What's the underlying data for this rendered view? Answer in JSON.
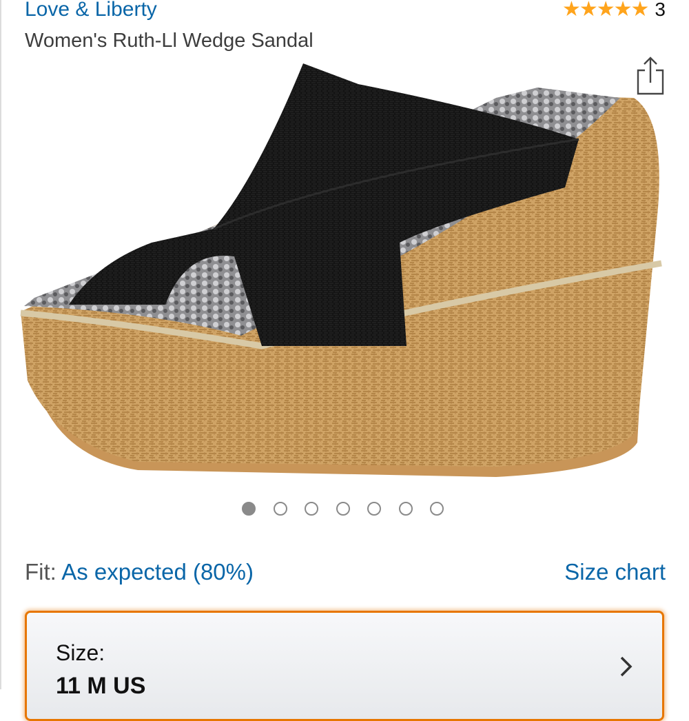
{
  "product": {
    "brand": "Love & Liberty",
    "title": "Women's Ruth-Ll Wedge Sandal",
    "rating_stars": "★★★★★",
    "rating_count": "3"
  },
  "icons": {
    "share": "share-icon",
    "chevron": "chevron-right-icon",
    "stars": "star-icon"
  },
  "carousel": {
    "total": 7,
    "active_index": 0
  },
  "fit": {
    "label": "Fit:",
    "value": "As expected (80%)",
    "size_chart": "Size chart"
  },
  "size_selector": {
    "label": "Size:",
    "value": "11 M US"
  },
  "colors": {
    "link": "#0a66a8",
    "star": "#ffa41c",
    "selector_border": "#e77600"
  }
}
